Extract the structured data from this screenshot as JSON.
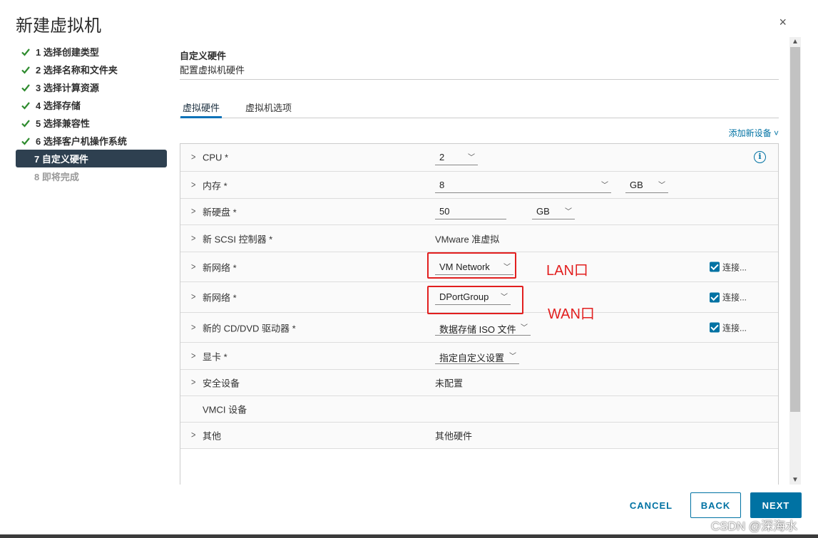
{
  "dialog": {
    "title": "新建虚拟机",
    "close_icon": "×"
  },
  "steps": [
    {
      "label": "1 选择创建类型",
      "done": true
    },
    {
      "label": "2 选择名称和文件夹",
      "done": true
    },
    {
      "label": "3 选择计算资源",
      "done": true
    },
    {
      "label": "4 选择存储",
      "done": true
    },
    {
      "label": "5 选择兼容性",
      "done": true
    },
    {
      "label": "6 选择客户机操作系统",
      "done": true
    },
    {
      "label": "7 自定义硬件",
      "current": true
    },
    {
      "label": "8 即将完成",
      "pending": true
    }
  ],
  "section": {
    "title": "自定义硬件",
    "subtitle": "配置虚拟机硬件"
  },
  "tabs": [
    {
      "label": "虚拟硬件",
      "active": true
    },
    {
      "label": "虚拟机选项"
    }
  ],
  "add_device": "添加新设备 ˅",
  "rows": {
    "cpu": {
      "label": "CPU *",
      "value": "2"
    },
    "memory": {
      "label": "内存 *",
      "value": "8",
      "unit": "GB"
    },
    "disk": {
      "label": "新硬盘 *",
      "value": "50",
      "unit": "GB"
    },
    "scsi": {
      "label": "新 SCSI 控制器 *",
      "value": "VMware 准虚拟"
    },
    "net1": {
      "label": "新网络 *",
      "value": "VM Network",
      "connect": "连接..."
    },
    "net2": {
      "label": "新网络 *",
      "value": "DPortGroup",
      "connect": "连接..."
    },
    "cdrom": {
      "label": "新的 CD/DVD 驱动器 *",
      "value": "数据存储 ISO 文件",
      "connect": "连接..."
    },
    "video": {
      "label": "显卡 *",
      "value": "指定自定义设置"
    },
    "security": {
      "label": "安全设备",
      "value": "未配置"
    },
    "vmci": {
      "label": "VMCI 设备"
    },
    "other": {
      "label": "其他",
      "value": "其他硬件"
    }
  },
  "annotations": {
    "lan": "LAN口",
    "wan": "WAN口",
    "color": "#e21f1f"
  },
  "buttons": {
    "cancel": "CANCEL",
    "back": "BACK",
    "next": "NEXT"
  },
  "watermark": "CSDN @深海水",
  "colors": {
    "accent": "#0072a3",
    "current_step_bg": "#2e4050",
    "check": "#2e8b2e"
  }
}
